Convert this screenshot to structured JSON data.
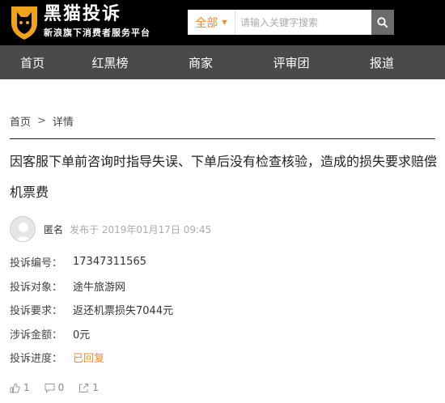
{
  "header": {
    "brand_title": "黑猫投诉",
    "brand_subtitle": "新浪旗下消费者服务平台",
    "search_category": "全部",
    "search_placeholder": "请输入关键字搜索"
  },
  "nav": {
    "items": [
      {
        "label": "首页"
      },
      {
        "label": "红黑榜"
      },
      {
        "label": "商家"
      },
      {
        "label": "评审团"
      },
      {
        "label": "报道"
      }
    ]
  },
  "breadcrumb": {
    "home": "首页",
    "sep": ">",
    "current": "详情"
  },
  "complaint": {
    "title": "因客服下单前咨询时指导失误、下单后没有检查核验，造成的损失要求赔偿机票费",
    "author": "匿名",
    "published": "发布于 2019年01月17日 09:45",
    "fields": [
      {
        "key": "投诉编号：",
        "value": "17347311565"
      },
      {
        "key": "投诉对象：",
        "value": "途牛旅游网"
      },
      {
        "key": "投诉要求：",
        "value": "返还机票损失7044元"
      },
      {
        "key": "涉诉金额：",
        "value": "0元"
      },
      {
        "key": "投诉进度：",
        "value": "已回复"
      }
    ]
  },
  "actions": {
    "likes": "1",
    "comments": "0",
    "shares": "1"
  },
  "colors": {
    "accent": "#f08b2c",
    "nav_bg": "#4a4a4a",
    "header_bg": "#000000"
  }
}
